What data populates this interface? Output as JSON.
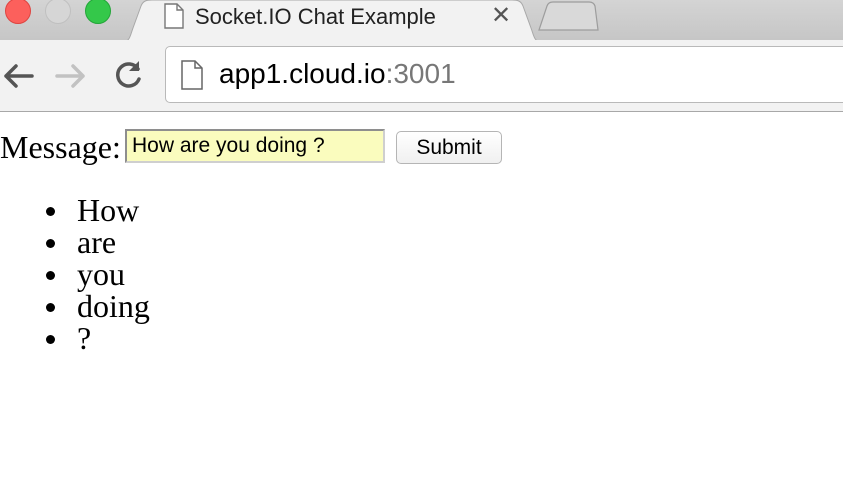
{
  "tab": {
    "title": "Socket.IO Chat Example",
    "close_glyph": "✕"
  },
  "address_bar": {
    "host": "app1.cloud.io",
    "port": ":3001"
  },
  "form": {
    "label": "Message:",
    "input_value": "How are you doing ?",
    "submit_label": "Submit"
  },
  "messages": [
    "How",
    "are",
    "you",
    "doing",
    "?"
  ],
  "colors": {
    "input_autofill_bg": "#fafcbe",
    "close_red": "#fc605c",
    "minimize_disabled": "#d6d6d6",
    "zoom_green": "#34c84a"
  },
  "icons": {
    "back": "back-arrow-icon",
    "forward": "forward-arrow-icon",
    "reload": "reload-icon",
    "page": "page-icon",
    "close": "close-icon"
  }
}
